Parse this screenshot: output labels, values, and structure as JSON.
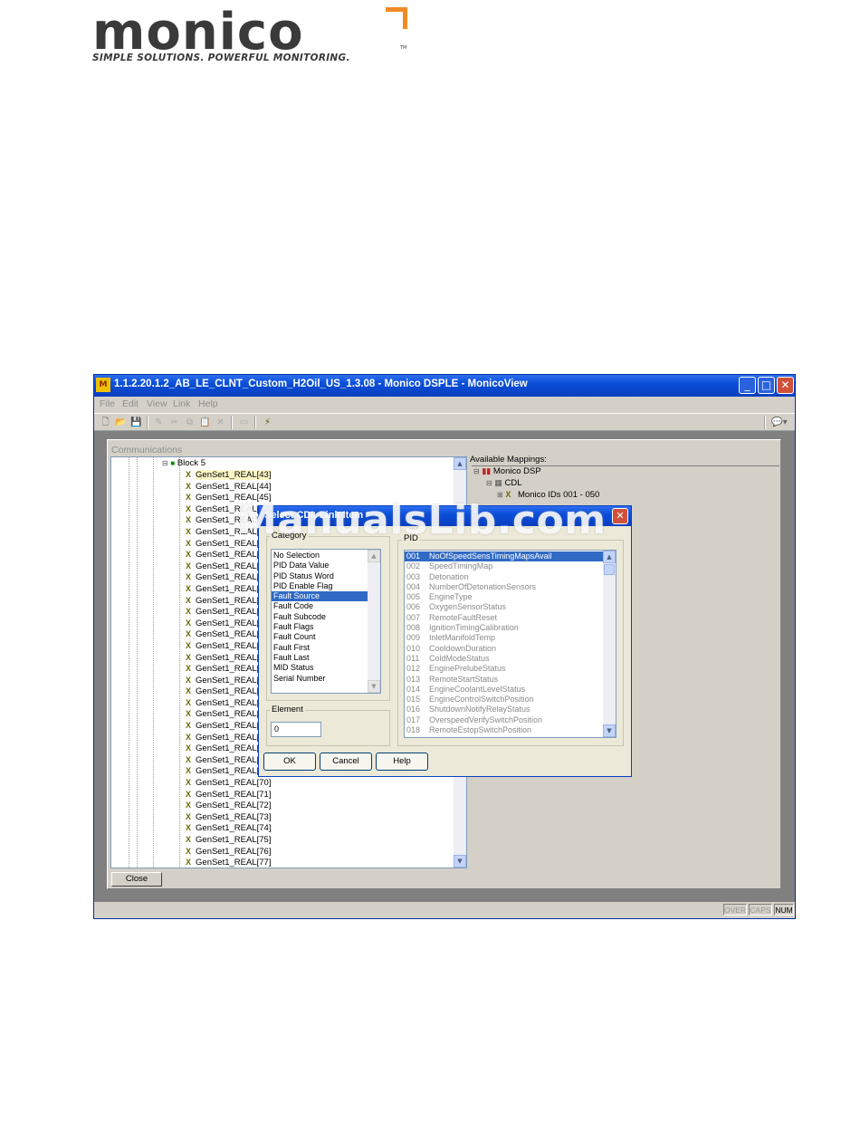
{
  "logo": {
    "word": "monico",
    "tagline": "SIMPLE SOLUTIONS. POWERFUL MONITORING.",
    "tm": "TM",
    "accent_color": "#f08a24"
  },
  "window": {
    "title": "1.1.2.20.1.2_AB_LE_CLNT_Custom_H2Oil_US_1.3.08 - Monico DSPLE - MonicoView",
    "menu": [
      "File",
      "Edit",
      "View",
      "Link",
      "Help"
    ],
    "toolbar_icons": [
      "new-icon",
      "open-icon",
      "save-icon",
      "edit-icon",
      "cut-icon",
      "copy-icon",
      "paste-icon",
      "delete-icon",
      "window-icon",
      "lightning-icon",
      "chat-icon"
    ]
  },
  "communications": {
    "title": "Communications",
    "block_label": "Block 5",
    "tree_items": [
      "GenSet1_REAL[43]",
      "GenSet1_REAL[44]",
      "GenSet1_REAL[45]",
      "GenSet1_REAL[46]",
      "GenSet1_REAL[47]",
      "GenSet1_REAL[48]",
      "GenSet1_REAL[49]",
      "GenSet1_REAL[50]",
      "GenSet1_REAL[51]",
      "GenSet1_REAL[52]",
      "GenSet1_REAL[53]",
      "GenSet1_REAL[54]",
      "GenSet1_REAL[55]",
      "GenSet1_REAL[56]",
      "GenSet1_REAL[57]",
      "GenSet1_REAL[58]",
      "GenSet1_REAL[59]",
      "GenSet1_REAL[60]",
      "GenSet1_REAL[61]",
      "GenSet1_REAL[62]",
      "GenSet1_REAL[63]",
      "GenSet1_REAL[64]",
      "GenSet1_REAL[65]",
      "GenSet1_REAL[66]",
      "GenSet1_REAL[67]",
      "GenSet1_REAL[68]",
      "GenSet1_REAL[69]",
      "GenSet1_REAL[70]",
      "GenSet1_REAL[71]",
      "GenSet1_REAL[72]",
      "GenSet1_REAL[73]",
      "GenSet1_REAL[74]",
      "GenSet1_REAL[75]",
      "GenSet1_REAL[76]",
      "GenSet1_REAL[77]"
    ],
    "close_label": "Close"
  },
  "mappings": {
    "title": "Available Mappings:",
    "root": "Monico DSP",
    "child": "CDL",
    "grandchild": "Monico IDs 001 - 050"
  },
  "dialog": {
    "title": "Select CDL Link Item",
    "category_label": "Category",
    "categories": [
      "No Selection",
      "PID Data Value",
      "PID Status Word",
      "PID Enable Flag",
      "Fault Source",
      "Fault Code",
      "Fault Subcode",
      "Fault Flags",
      "Fault Count",
      "Fault First",
      "Fault Last",
      "MID Status",
      "Serial Number"
    ],
    "selected_category": 4,
    "pid_label": "PID",
    "pids": [
      {
        "num": "001",
        "name": "NoOfSpeedSensTimingMapsAvail"
      },
      {
        "num": "002",
        "name": "SpeedTimingMap"
      },
      {
        "num": "003",
        "name": "Detonation"
      },
      {
        "num": "004",
        "name": "NumberOfDetonationSensors"
      },
      {
        "num": "005",
        "name": "EngineType"
      },
      {
        "num": "006",
        "name": "OxygenSensorStatus"
      },
      {
        "num": "007",
        "name": "RemoteFaultReset"
      },
      {
        "num": "008",
        "name": "IgnitionTimingCalibration"
      },
      {
        "num": "009",
        "name": "InletManifoldTemp"
      },
      {
        "num": "010",
        "name": "CooldownDuration"
      },
      {
        "num": "011",
        "name": "ColdModeStatus"
      },
      {
        "num": "012",
        "name": "EnginePrelubeStatus"
      },
      {
        "num": "013",
        "name": "RemoteStartStatus"
      },
      {
        "num": "014",
        "name": "EngineCoolantLevelStatus"
      },
      {
        "num": "015",
        "name": "EngineControlSwitchPosition"
      },
      {
        "num": "016",
        "name": "ShutdownNotifyRelayStatus"
      },
      {
        "num": "017",
        "name": "OverspeedVerifySwitchPosition"
      },
      {
        "num": "018",
        "name": "RemoteEstopSwitchPosition"
      }
    ],
    "element_label": "Element",
    "element_value": "0",
    "ok_label": "OK",
    "cancel_label": "Cancel",
    "help_label": "Help"
  },
  "status": {
    "over": "OVER",
    "caps": "CAPS",
    "num": "NUM"
  },
  "watermark": "ManualsLib.com"
}
